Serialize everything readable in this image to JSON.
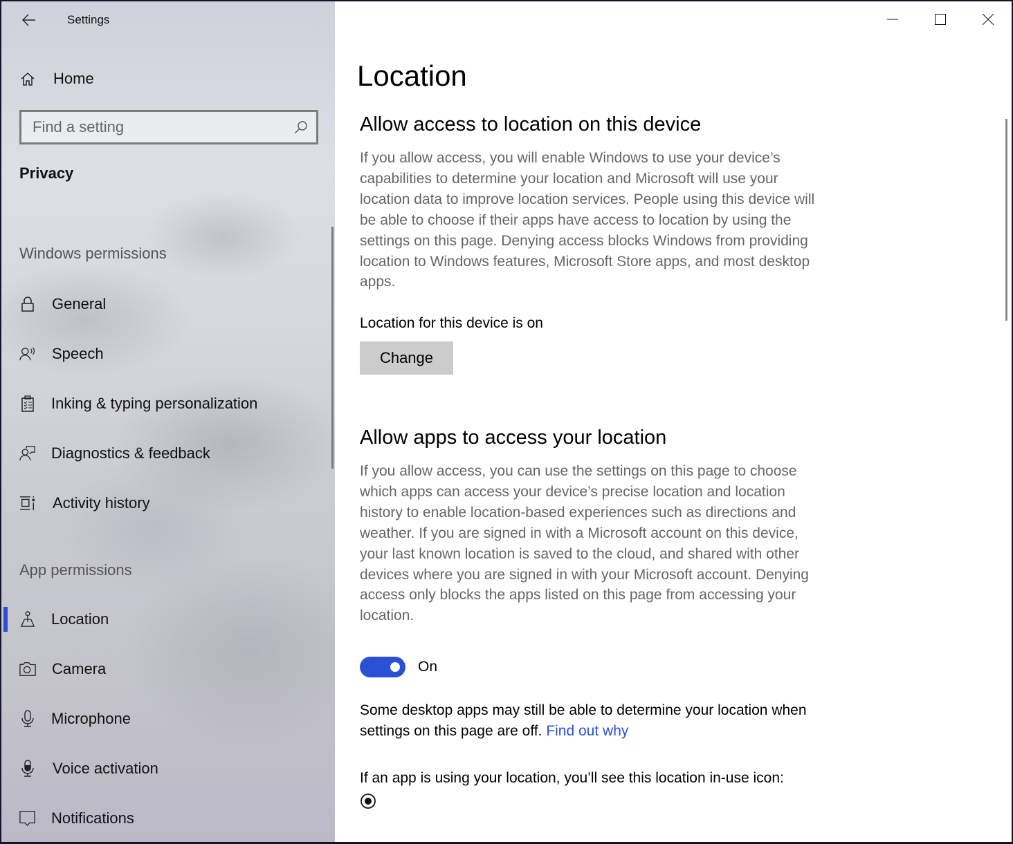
{
  "window": {
    "title": "Settings",
    "controls": {
      "minimize": "minimize-icon",
      "maximize": "maximize-icon",
      "close": "close-icon"
    }
  },
  "sidebar": {
    "back_icon": "back-arrow-icon",
    "home": {
      "label": "Home",
      "icon": "home-icon"
    },
    "search": {
      "placeholder": "Find a setting",
      "value": "",
      "icon": "search-icon"
    },
    "category": "Privacy",
    "groups": [
      {
        "heading": "Windows permissions",
        "items": [
          {
            "label": "General",
            "icon": "lock-icon"
          },
          {
            "label": "Speech",
            "icon": "speech-icon"
          },
          {
            "label": "Inking & typing personalization",
            "icon": "clipboard-icon"
          },
          {
            "label": "Diagnostics & feedback",
            "icon": "feedback-icon"
          },
          {
            "label": "Activity history",
            "icon": "timeline-icon"
          }
        ]
      },
      {
        "heading": "App permissions",
        "items": [
          {
            "label": "Location",
            "icon": "location-icon",
            "selected": true
          },
          {
            "label": "Camera",
            "icon": "camera-icon"
          },
          {
            "label": "Microphone",
            "icon": "microphone-icon"
          },
          {
            "label": "Voice activation",
            "icon": "voice-activation-icon"
          },
          {
            "label": "Notifications",
            "icon": "notifications-icon"
          }
        ]
      }
    ]
  },
  "main": {
    "title": "Location",
    "device_section": {
      "heading": "Allow access to location on this device",
      "description": "If you allow access, you will enable Windows to use your device’s capabilities to determine your location and Microsoft will use your location data to improve location services. People using this device will be able to choose if their apps have access to location by using the settings on this page. Denying access blocks Windows from providing location to Windows features, Microsoft Store apps, and most desktop apps.",
      "status": "Location for this device is on",
      "change_button": "Change"
    },
    "apps_section": {
      "heading": "Allow apps to access your location",
      "description": "If you allow access, you can use the settings on this page to choose which apps can access your device’s precise location and location history to enable location-based experiences such as directions and weather. If you are signed in with a Microsoft account on this device, your last known location is saved to the cloud, and shared with other devices where you are signed in with your Microsoft account. Denying access only blocks the apps listed on this page from accessing your location.",
      "toggle": {
        "state": true,
        "label": "On"
      },
      "note": "Some desktop apps may still be able to determine your location when settings on this page are off.",
      "note_link": "Find out why",
      "inuse_text": "If an app is using your location, you’ll see this location in-use icon:",
      "inuse_icon": "location-in-use-icon"
    }
  },
  "colors": {
    "accent": "#2a50d6",
    "description_text": "#666666",
    "button_bg": "#cccccc"
  }
}
